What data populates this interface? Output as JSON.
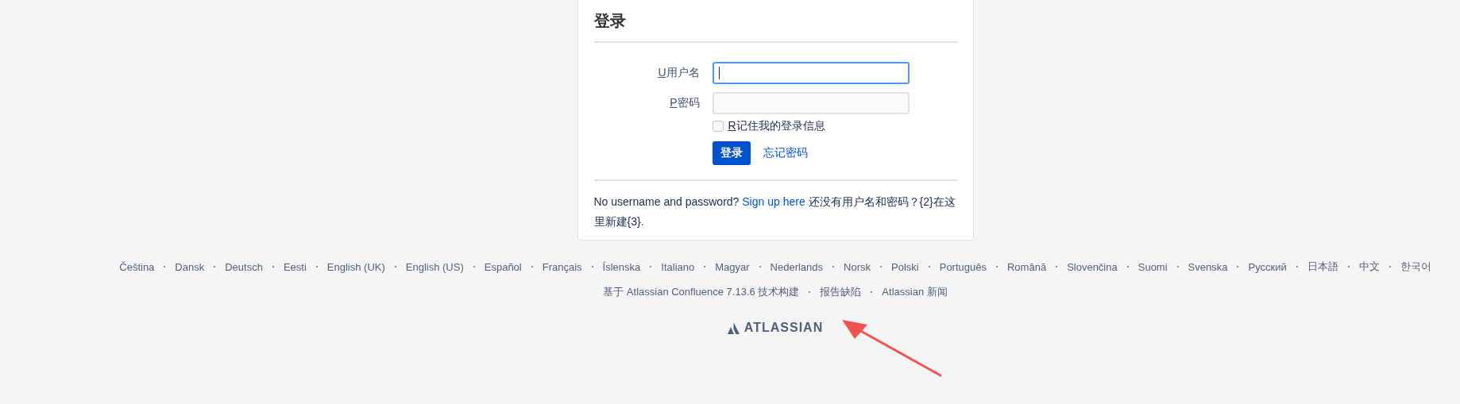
{
  "login": {
    "title": "登录",
    "fields": [
      {
        "access_key": "U",
        "label": "用户名",
        "focused": true
      },
      {
        "access_key": "P",
        "label": "密码",
        "focused": false
      }
    ],
    "remember": {
      "access_key": "R",
      "label": "记住我的登录信息",
      "checked": false
    },
    "submit": "登录",
    "forgot": "忘记密码",
    "signup": {
      "before": "No username and password?",
      "link": "Sign up here",
      "after": "还没有用户名和密码？{2}在这里新建{3}."
    }
  },
  "footer": {
    "languages": [
      "Čeština",
      "Dansk",
      "Deutsch",
      "Eesti",
      "English (UK)",
      "English (US)",
      "Español",
      "Français",
      "Íslenska",
      "Italiano",
      "Magyar",
      "Nederlands",
      "Norsk",
      "Polski",
      "Português",
      "Română",
      "Slovenčina",
      "Suomi",
      "Svenska",
      "Русский",
      "日本語",
      "中文",
      "한국어"
    ],
    "links": [
      "基于 Atlassian Confluence 7.13.6 技术构建",
      "报告缺陷",
      "Atlassian 新闻"
    ],
    "logo": "ATLASSIAN"
  }
}
